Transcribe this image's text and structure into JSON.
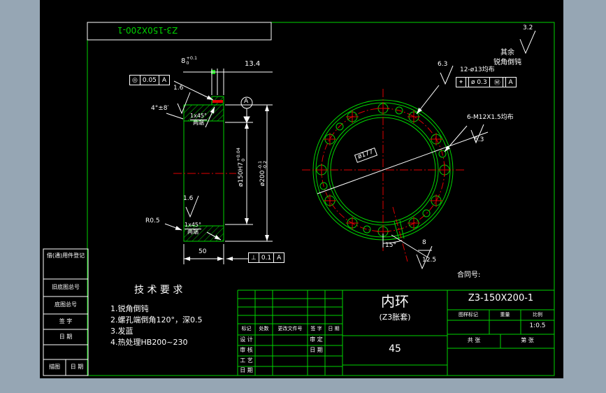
{
  "colors": {
    "background": "#96a6b4",
    "canvas": "#000000",
    "green": "#00d400",
    "red": "#e00000",
    "white": "#ffffff"
  },
  "flip_title": "Z3-150X200-1",
  "side_panel": {
    "cells": [
      "借(通)用件登记",
      "旧底图总号",
      "底图总号",
      "签 字",
      "日 期",
      ""
    ],
    "bottom": [
      "描图",
      "日 期"
    ]
  },
  "section": {
    "dim_step": "8",
    "dim_step_tol_up": "+0.1",
    "dim_step_tol_dn": "0",
    "dim_width2": "13.4",
    "angle": "4°±8′",
    "fcf_concentric": {
      "sym": "◎",
      "tol": "0.05",
      "datum": "A"
    },
    "rough_top": "1.6",
    "rough_bottom": "1.6",
    "fillet": "R0.5",
    "chamfer": "1x45°",
    "chamfer_note": "两端",
    "datum_label": "A",
    "bore_dia": "ø150H7",
    "bore_tol_up": "+0.04",
    "bore_tol_dn": "0",
    "od_dia": "ø200",
    "od_tol_up": "-0.1",
    "od_tol_dn": "-0.2",
    "dim_length": "50",
    "fcf_perp": {
      "sym": "⊥",
      "tol": "0.1",
      "datum": "A"
    }
  },
  "circle": {
    "rough_default": "3.2",
    "note_rest": "其余",
    "note_edges": "锐角倒钝",
    "rough_holes": "6.3",
    "holes_label": "12-ø13均布",
    "fcf_pos": {
      "sym": "⌖",
      "tol": "ø 0.3",
      "mod": "Ⓜ",
      "datum": "A"
    },
    "tapped_label": "6-M12X1.5均布",
    "rough_tapped": "6.3",
    "bolt_circle_dia": "ø177",
    "slot_angle": "15°",
    "slot_width": "8",
    "rough_slot": "12.5"
  },
  "tech": {
    "title": "技 术 要 求",
    "items": [
      "1.锐角倒钝",
      "2.螺孔端倒角120°，深0.5",
      "3.发蓝",
      "4.热处理HB200~230"
    ]
  },
  "tb": {
    "contract_label": "合同号:",
    "rev_headers": [
      "标记",
      "处数",
      "更改文件号",
      "签 字",
      "日 期"
    ],
    "sig_rows": [
      "设 计",
      "审 核",
      "工 艺",
      "日 期"
    ],
    "sig_rows2": [
      "审 定",
      "日 期"
    ],
    "part_name": "内环",
    "part_sub": "(Z3胀套)",
    "material": "45",
    "drawing_no": "Z3-150X200-1",
    "col_headers": [
      "图样标记",
      "重量",
      "比例"
    ],
    "scale": "1:0.5",
    "sheets": [
      "共  张",
      "第  张"
    ]
  }
}
